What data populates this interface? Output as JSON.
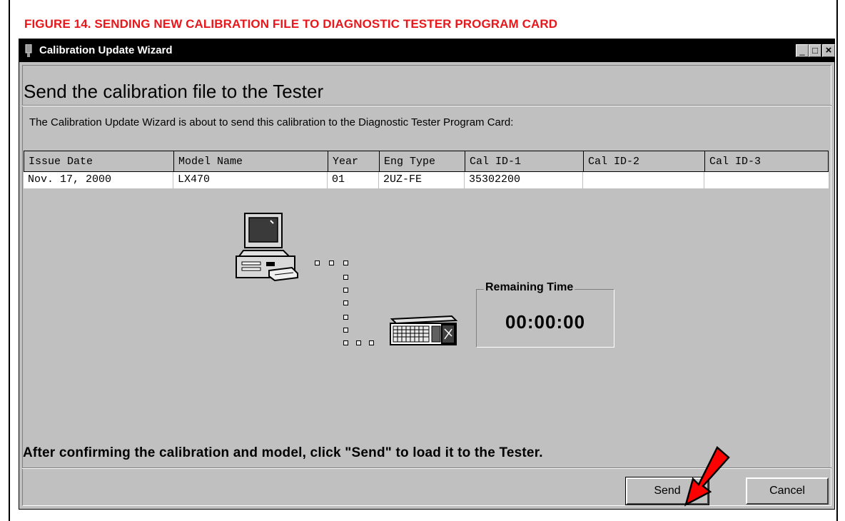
{
  "figure": {
    "caption": "FIGURE 14.  SENDING NEW CALIBRATION FILE TO DIAGNOSTIC TESTER PROGRAM CARD"
  },
  "window": {
    "title": "Calibration Update Wizard",
    "controls": {
      "minimize": "_",
      "maximize": "□",
      "close": "×"
    }
  },
  "wizard": {
    "heading": "Send the calibration file to the Tester",
    "description": "The Calibration Update Wizard is about to send this calibration to the Diagnostic Tester Program Card:",
    "instruction": "After confirming the calibration and model, click \"Send\" to load it to the Tester."
  },
  "table": {
    "columns": [
      "Issue Date",
      "Model Name",
      "Year",
      "Eng Type",
      "Cal ID-1",
      "Cal ID-2",
      "Cal ID-3"
    ],
    "rows": [
      [
        "Nov. 17, 2000",
        "LX470",
        "01",
        "2UZ-FE",
        "35302200",
        "",
        ""
      ]
    ]
  },
  "remaining_time": {
    "label": "Remaining Time",
    "value": "00:00:00"
  },
  "buttons": {
    "send": "Send",
    "cancel": "Cancel"
  },
  "colors": {
    "caption": "#e8171b",
    "window_bg": "#c0c0c0",
    "titlebar": "#000000",
    "arrow": "#ff0000"
  },
  "icons": [
    "app-icon",
    "computer-icon",
    "tester-icon",
    "red-arrow-icon"
  ]
}
